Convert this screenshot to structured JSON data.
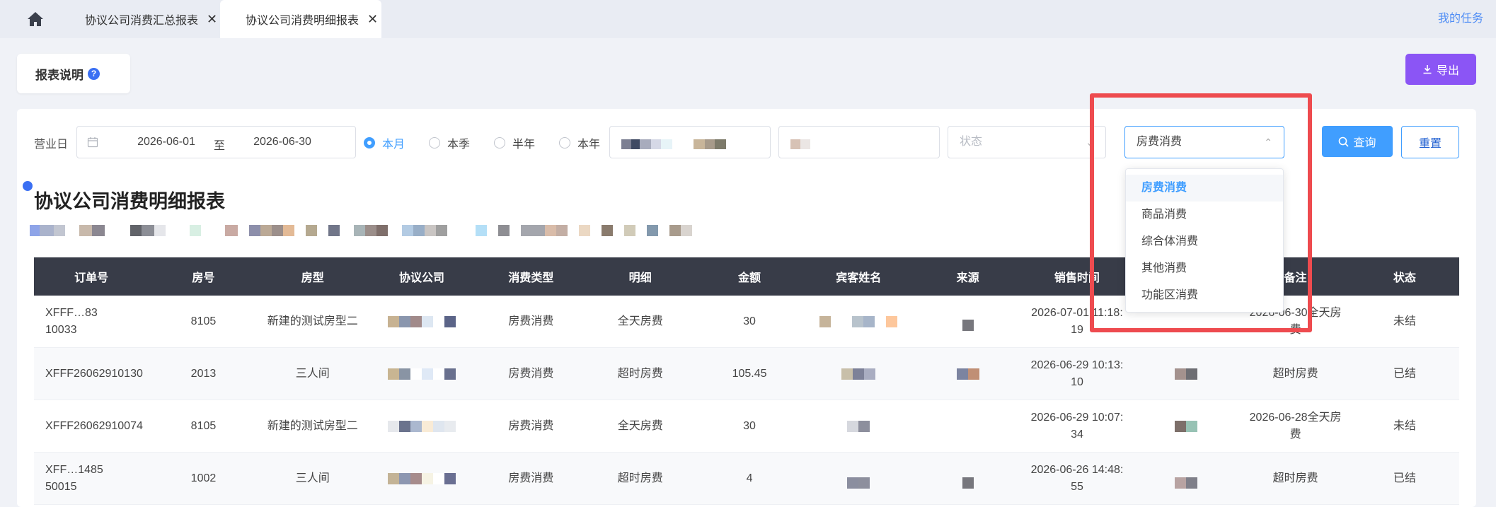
{
  "tabs": {
    "home_icon": "home-icon",
    "items": [
      {
        "label": "协议公司消费汇总报表",
        "active": false
      },
      {
        "label": "协议公司消费明细报表",
        "active": true
      }
    ],
    "close_glyph": "✕",
    "my_tasks": "我的任务"
  },
  "header": {
    "report_desc": "报表说明",
    "help_glyph": "?",
    "export_label": "导出",
    "export_icon": "download-icon"
  },
  "filters": {
    "business_day_label": "营业日",
    "date_start": "2026-06-01",
    "date_sep": "至",
    "date_end": "2026-06-30",
    "period_options": [
      {
        "label": "本月",
        "selected": true
      },
      {
        "label": "本季",
        "selected": false
      },
      {
        "label": "半年",
        "selected": false
      },
      {
        "label": "本年",
        "selected": false
      }
    ],
    "status_placeholder": "状态",
    "consumption_type_value": "房费消费",
    "query_label": "查询",
    "reset_label": "重置"
  },
  "dropdown": {
    "options": [
      "房费消费",
      "商品消费",
      "综合体消费",
      "其他消费",
      "功能区消费"
    ],
    "selected_index": 0
  },
  "report": {
    "title": "协议公司消费明细报表"
  },
  "table": {
    "headers": [
      "订单号",
      "房号",
      "房型",
      "协议公司",
      "消费类型",
      "明细",
      "金额",
      "宾客姓名",
      "来源",
      "销售时间",
      "",
      "备注",
      "状态"
    ],
    "rows": [
      {
        "order": "XFFF…83\n10033",
        "room": "8105",
        "room_type": "新建的测试房型二",
        "type": "房费消费",
        "detail": "全天房费",
        "amount": "30",
        "time": "2026-07-01 11:18:\n19",
        "remark": "2026-06-30全天房\n费",
        "status": "未结"
      },
      {
        "order": "XFFF26062910130",
        "room": "2013",
        "room_type": "三人间",
        "type": "房费消费",
        "detail": "超时房费",
        "amount": "105.45",
        "time": "2026-06-29 10:13:\n10",
        "remark": "超时房费",
        "status": "已结"
      },
      {
        "order": "XFFF26062910074",
        "room": "8105",
        "room_type": "新建的测试房型二",
        "type": "房费消费",
        "detail": "全天房费",
        "amount": "30",
        "time": "2026-06-29 10:07:\n34",
        "remark": "2026-06-28全天房\n费",
        "status": "未结"
      },
      {
        "order": "XFF…1485\n50015",
        "room": "1002",
        "room_type": "三人间",
        "type": "房费消费",
        "detail": "超时房费",
        "amount": "4",
        "time": "2026-06-26 14:48:\n55",
        "remark": "超时房费",
        "status": "已结"
      }
    ]
  },
  "colors": {
    "primary": "#409eff",
    "export": "#8b55f5",
    "table_header": "#383c48",
    "highlight": "#ee4b4f"
  }
}
